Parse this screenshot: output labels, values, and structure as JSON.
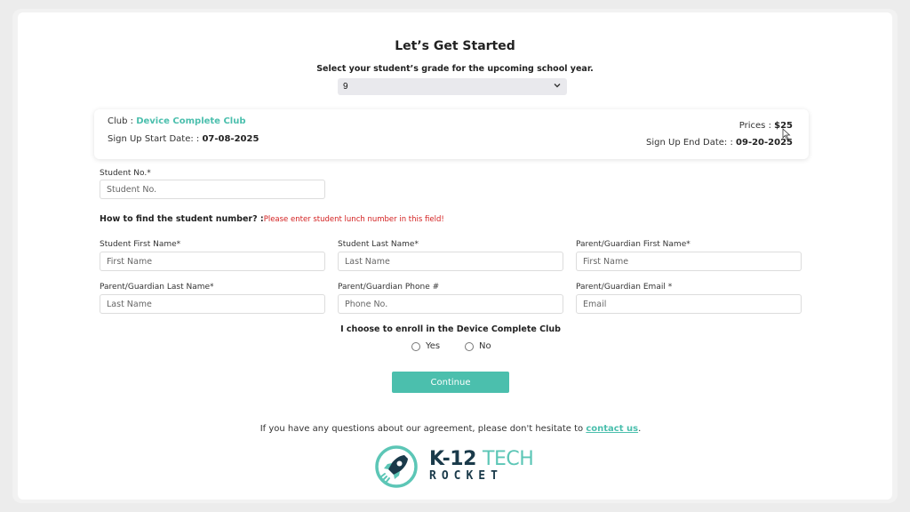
{
  "header": {
    "title": "Let’s Get Started",
    "grade_prompt": "Select your student’s grade for the upcoming school year.",
    "grade_value": "9"
  },
  "club": {
    "club_label": "Club : ",
    "club_name": "Device Complete Club",
    "start_label": "Sign Up Start Date: : ",
    "start_date": "07-08-2025",
    "price_label": "Prices : ",
    "price": "$25",
    "end_label": "Sign Up End Date: : ",
    "end_date": "09-20-2025"
  },
  "form": {
    "student_no": {
      "label": "Student No.*",
      "placeholder": "Student No."
    },
    "help_question": "How to find the student number? :",
    "help_note": "Please enter student lunch number in this field!",
    "student_first": {
      "label": "Student First Name*",
      "placeholder": "First Name"
    },
    "student_last": {
      "label": "Student Last Name*",
      "placeholder": "Last Name"
    },
    "parent_first": {
      "label": "Parent/Guardian First Name*",
      "placeholder": "First Name"
    },
    "parent_last": {
      "label": "Parent/Guardian Last Name*",
      "placeholder": "Last Name"
    },
    "parent_phone": {
      "label": "Parent/Guardian Phone #",
      "placeholder": "Phone No."
    },
    "parent_email": {
      "label": "Parent/Guardian Email *",
      "placeholder": "Email"
    },
    "enroll_prompt": "I choose to enroll in the Device Complete Club",
    "yes_label": "Yes",
    "no_label": "No",
    "continue_label": "Continue"
  },
  "footer": {
    "text": "If you have any questions about our agreement, please don't hesitate to ",
    "link": "contact us",
    "period": "."
  },
  "logo": {
    "k12": "K-12 ",
    "tech": "TECH",
    "rocket": "ROCKET"
  },
  "colors": {
    "accent": "#4bbfad",
    "warning": "#d32020",
    "logo_dark": "#1a3a4a"
  }
}
